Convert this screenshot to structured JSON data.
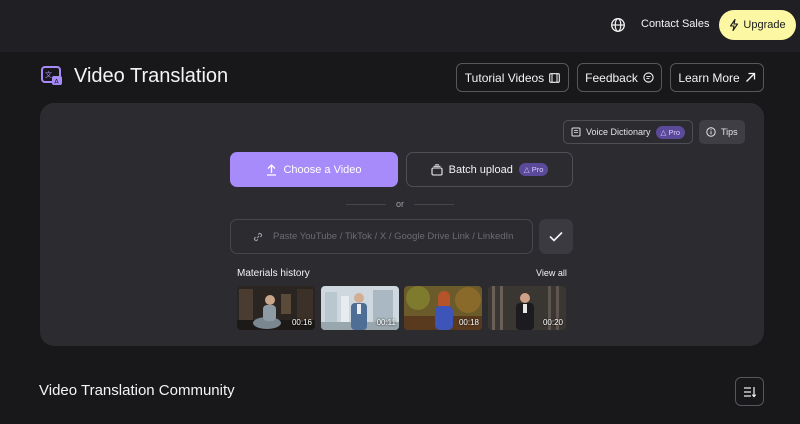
{
  "header": {
    "language_icon": "globe-icon",
    "contact_label": "Contact Sales",
    "upgrade_label": "Upgrade"
  },
  "page": {
    "title": "Video Translation",
    "tutorial_label": "Tutorial Videos",
    "feedback_label": "Feedback",
    "learn_more_label": "Learn More"
  },
  "panel": {
    "voice_dictionary_label": "Voice Dictionary",
    "pro_badge": "Pro",
    "tips_label": "Tips",
    "choose_video_label": "Choose a Video",
    "batch_upload_label": "Batch upload",
    "or_label": "or",
    "link_placeholder": "Paste YouTube / TikTok / X / Google Drive Link / LinkedIn",
    "link_value": ""
  },
  "history": {
    "label": "Materials history",
    "view_all": "View all",
    "items": [
      {
        "duration": "00:16"
      },
      {
        "duration": "00:11"
      },
      {
        "duration": "00:18"
      },
      {
        "duration": "00:20"
      }
    ]
  },
  "community": {
    "title": "Video Translation Community"
  },
  "colors": {
    "background": "#18181b",
    "topbar": "#202024",
    "panel": "#2b2b30",
    "accent_purple": "#a78bfa",
    "upgrade_yellow": "#fbf7a3",
    "pro_badge": "#5b4a9a"
  }
}
